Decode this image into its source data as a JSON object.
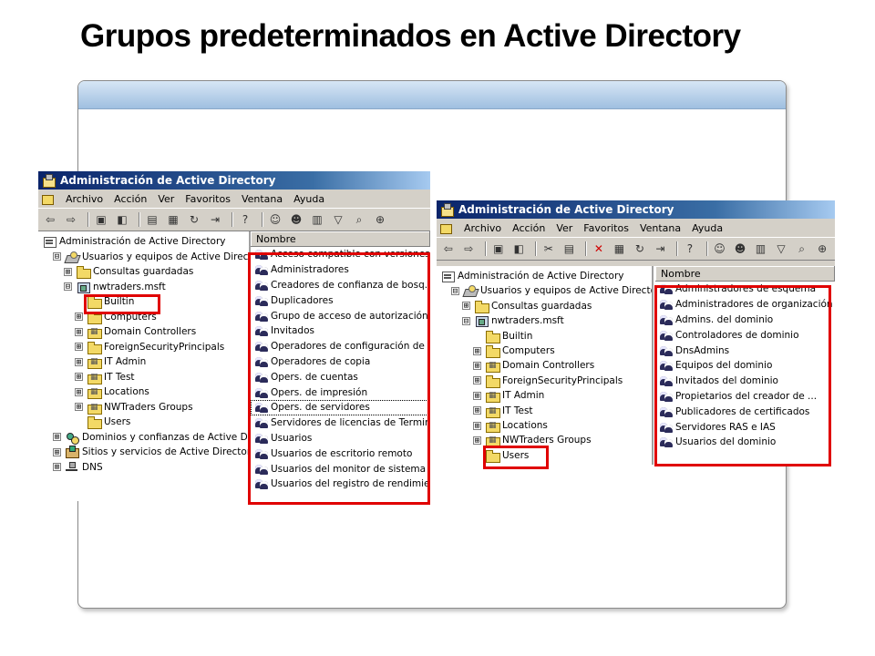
{
  "slide": {
    "title": "Grupos predeterminados en Active Directory"
  },
  "colors": {
    "highlight": "#e00000",
    "titlebar": "#0a246a"
  },
  "left_window": {
    "title": "Administración de Active Directory",
    "menu": [
      "Archivo",
      "Acción",
      "Ver",
      "Favoritos",
      "Ventana",
      "Ayuda"
    ],
    "tree": [
      {
        "label": "Administración de Active Directory",
        "icon": "console-root-icon"
      },
      {
        "label": "Usuarios y equipos de Active Directory",
        "icon": "aduc-icon",
        "expander": "⊟"
      },
      {
        "label": "Consultas guardadas",
        "icon": "folder-icon",
        "expander": "⊞"
      },
      {
        "label": "nwtraders.msft",
        "icon": "domain-icon",
        "expander": "⊟"
      },
      {
        "label": "Builtin",
        "icon": "folder-icon",
        "expander": ""
      },
      {
        "label": "Computers",
        "icon": "folder-icon",
        "expander": "⊞"
      },
      {
        "label": "Domain Controllers",
        "icon": "ou-icon",
        "expander": "⊞"
      },
      {
        "label": "ForeignSecurityPrincipals",
        "icon": "folder-icon",
        "expander": "⊞"
      },
      {
        "label": "IT Admin",
        "icon": "ou-icon",
        "expander": "⊞"
      },
      {
        "label": "IT Test",
        "icon": "ou-icon",
        "expander": "⊞"
      },
      {
        "label": "Locations",
        "icon": "ou-icon",
        "expander": "⊞"
      },
      {
        "label": "NWTraders Groups",
        "icon": "ou-icon",
        "expander": "⊞"
      },
      {
        "label": "Users",
        "icon": "folder-icon",
        "expander": ""
      },
      {
        "label": "Dominios y confianzas de Active Directo",
        "icon": "trusts-icon",
        "expander": "⊞"
      },
      {
        "label": "Sitios y servicios de Active Directory",
        "icon": "sites-icon",
        "expander": "⊞"
      },
      {
        "label": "DNS",
        "icon": "dns-icon",
        "expander": "⊞"
      }
    ],
    "list_header": "Nombre",
    "list": [
      "Acceso compatible con versiones ...",
      "Administradores",
      "Creadores de confianza de bosq...",
      "Duplicadores",
      "Grupo de acceso de autorización ...",
      "Invitados",
      "Operadores de configuración de ...",
      "Operadores de copia",
      "Opers. de cuentas",
      "Opers. de impresión",
      "Opers. de servidores",
      "Servidores de licencias de Termin...",
      "Usuarios",
      "Usuarios de escritorio remoto",
      "Usuarios del monitor de sistema",
      "Usuarios del registro de rendimiento"
    ]
  },
  "right_window": {
    "title": "Administración de Active Directory",
    "menu": [
      "Archivo",
      "Acción",
      "Ver",
      "Favoritos",
      "Ventana",
      "Ayuda"
    ],
    "tree": [
      {
        "label": "Administración de Active Directory",
        "icon": "console-root-icon"
      },
      {
        "label": "Usuarios y equipos de Active Directory",
        "icon": "aduc-icon",
        "expander": "⊟"
      },
      {
        "label": "Consultas guardadas",
        "icon": "folder-icon",
        "expander": "⊞"
      },
      {
        "label": "nwtraders.msft",
        "icon": "domain-icon",
        "expander": "⊟"
      },
      {
        "label": "Builtin",
        "icon": "folder-icon",
        "expander": ""
      },
      {
        "label": "Computers",
        "icon": "folder-icon",
        "expander": "⊞"
      },
      {
        "label": "Domain Controllers",
        "icon": "ou-icon",
        "expander": "⊞"
      },
      {
        "label": "ForeignSecurityPrincipals",
        "icon": "folder-icon",
        "expander": "⊞"
      },
      {
        "label": "IT Admin",
        "icon": "ou-icon",
        "expander": "⊞"
      },
      {
        "label": "IT Test",
        "icon": "ou-icon",
        "expander": "⊞"
      },
      {
        "label": "Locations",
        "icon": "ou-icon",
        "expander": "⊞"
      },
      {
        "label": "NWTraders Groups",
        "icon": "ou-icon",
        "expander": "⊞"
      },
      {
        "label": "Users",
        "icon": "folder-icon",
        "expander": ""
      }
    ],
    "list_header": "Nombre",
    "list": [
      "Administradores de esquema",
      "Administradores de organización",
      "Admins. del dominio",
      "Controladores de dominio",
      "DnsAdmins",
      "Equipos del dominio",
      "Invitados del dominio",
      "Propietarios del creador de ...",
      "Publicadores de certificados",
      "Servidores RAS e IAS",
      "Usuarios del dominio"
    ]
  }
}
